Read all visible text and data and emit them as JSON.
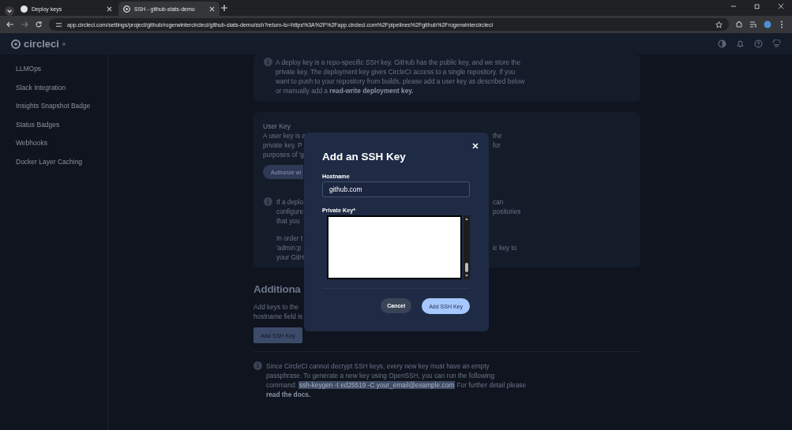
{
  "browser": {
    "tabs": [
      {
        "title": "Deploy keys",
        "selected": false
      },
      {
        "title": "SSH - github-stats-demo",
        "selected": true
      }
    ],
    "url": "app.circleci.com/settings/project/github/rogerwintercircleci/github-stats-demo/ssh?return-to=https%3A%2F%2Fapp.circleci.com%2Fpipelines%2Fgithub%2Frogerwintercircleci"
  },
  "app_header": {
    "logo": "circleci"
  },
  "sidebar": {
    "items": [
      "LLMOps",
      "Slack Integration",
      "Insights Snapshot Badge",
      "Status Badges",
      "Webhooks",
      "Docker Layer Caching"
    ]
  },
  "deploy_key_card": {
    "text": "A deploy key is a repo-specific SSH key. GitHub has the public key, and we store the private key. The deployment key gives CircleCI access to a single repository. If you want to push to your repository from builds, please add a user key as described below or manually add a **read-write deployment key.**"
  },
  "user_key_card": {
    "title": "User Key",
    "lines": [
      {
        "left": "A user key is a",
        "right": "the"
      },
      {
        "left": "private key. P",
        "right": "for"
      },
      {
        "left": "purposes of 'g"
      }
    ],
    "button": "Authorize wi",
    "info_paragraphs": [
      [
        {
          "left": "If a deplo",
          "right": "can"
        },
        {
          "left": "configure",
          "right": "positories"
        },
        {
          "left": "that you"
        }
      ],
      [
        {
          "left": "In order t"
        },
        {
          "left": "'admin:p",
          "right": "ic key to"
        },
        {
          "left": "your GitH"
        }
      ]
    ]
  },
  "additional": {
    "heading": "Additiona",
    "lines": [
      "Add keys to the",
      "hostname field is"
    ],
    "button": "Add SSH Key"
  },
  "note": {
    "before": "Since CircleCI cannot decrypt SSH keys, every new key must have an empty passphrase. To generate a new key using OpenSSH, you can run the following command: ",
    "code": "ssh-keygen -t ed25519 -C your_email@example.com",
    "after": " For further detail please ",
    "link": "read the docs."
  },
  "modal": {
    "title": "Add an SSH Key",
    "hostname_label": "Hostname",
    "hostname_value": "github.com",
    "private_key_label": "Private Key*",
    "cancel": "Cancel",
    "submit": "Add SSH Key"
  }
}
